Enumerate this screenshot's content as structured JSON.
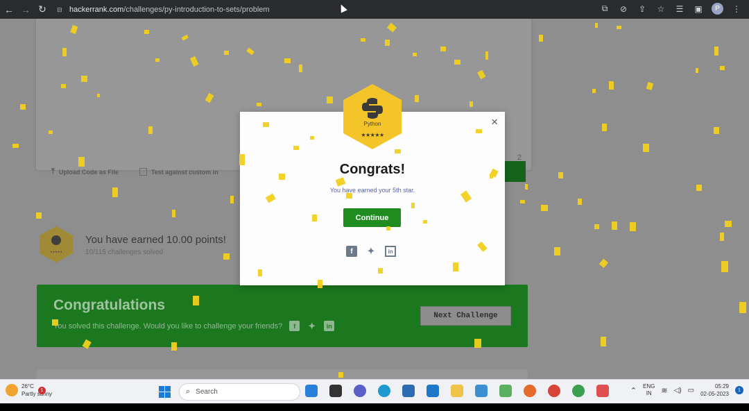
{
  "browser": {
    "url_host": "hackerrank.com",
    "url_path": "/challenges/py-introduction-to-sets/problem"
  },
  "page": {
    "upload_label": "Upload Code as File",
    "test_label": "Test against custom in",
    "line_count": "2",
    "points_text": "You have earned 10.00 points!",
    "points_sub": "10/115 challenges solved",
    "badge_small_label": "Python",
    "congrats_title": "Congratulations",
    "congrats_sub": "You solved this challenge. Would you like to challenge your friends?",
    "next_button": "Next Challenge"
  },
  "modal": {
    "badge_label": "Python",
    "title": "Congrats!",
    "subtitle": "You have earned your 5th star.",
    "continue_label": "Continue",
    "close_symbol": "×",
    "share": [
      "facebook-icon",
      "twitter-icon",
      "linkedin-icon"
    ]
  },
  "taskbar": {
    "weather_temp": "26°C",
    "weather_desc": "Partly sunny",
    "weather_badge": "1",
    "search_placeholder": "Search",
    "lang_top": "ENG",
    "lang_bottom": "IN",
    "time": "05:29",
    "date": "02-05-2023",
    "notification_count": "1"
  },
  "colors": {
    "brand_green": "#1e8c1f",
    "badge_yellow": "#f3c52b",
    "confetti": "#f2cf1d"
  }
}
